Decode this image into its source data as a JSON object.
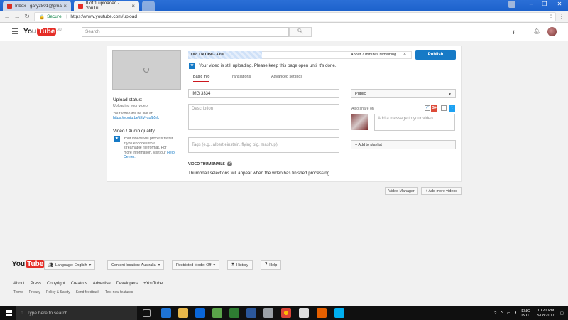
{
  "browser": {
    "tabs": [
      {
        "label": "Inbox - gary3801@gmai"
      },
      {
        "label": "0 of 1 uploaded - YouTu"
      }
    ],
    "secure_label": "Secure",
    "url": "https://www.youtube.com/upload"
  },
  "header": {
    "logo_left": "You",
    "logo_right": "Tube",
    "logo_region": "AU",
    "search_placeholder": "Search"
  },
  "upload": {
    "status_heading": "Upload status:",
    "status_text": "Uploading your video.",
    "live_at_label": "Your video will be live at:",
    "live_link": "https://youtu.be/tEVvspfb5rk",
    "quality_heading": "Video / Audio quality:",
    "quality_text": "Your videos will process faster if you encode into a streamable file format. For more information, visit our",
    "help_center": "Help Center.",
    "progress_label": "UPLOADING 33%",
    "progress_percent": 33,
    "remaining_label": "About 7 minutes remaining.",
    "publish_label": "Publish",
    "notice": "Your video is still uploading. Please keep this page open until it's done.",
    "tabs": [
      "Basic info",
      "Translations",
      "Advanced settings"
    ],
    "title_value": "IMG 3334",
    "description_placeholder": "Description",
    "tags_placeholder": "Tags (e.g., albert einstein, flying pig, mashup)",
    "privacy_value": "Public",
    "also_share_on": "Also share on",
    "message_placeholder": "Add a message to your video",
    "add_to_playlist": "+ Add to playlist",
    "thumbnails_heading": "VIDEO THUMBNAILS",
    "thumbnails_text": "Thumbnail selections will appear when the video has finished processing.",
    "video_manager": "Video Manager",
    "add_more_videos": "+ Add more videos"
  },
  "footer": {
    "logo_left": "You",
    "logo_right": "Tube",
    "language": "Language: English",
    "location": "Content location: Australia",
    "restricted": "Restricted Mode: Off",
    "history": "History",
    "help": "Help",
    "links_primary": [
      "About",
      "Press",
      "Copyright",
      "Creators",
      "Advertise",
      "Developers",
      "+YouTube"
    ],
    "links_secondary": [
      "Terms",
      "Privacy",
      "Policy & Safety",
      "Send feedback",
      "Test new features"
    ]
  },
  "taskbar": {
    "search_placeholder": "Type here to search",
    "lang": "ENG",
    "layout": "INTL",
    "time": "10:21 PM",
    "date": "5/08/2017"
  },
  "colors": {
    "brand_red": "#e52d27",
    "accent_blue": "#167ac6",
    "chrome_blue": "#1d62cc"
  }
}
